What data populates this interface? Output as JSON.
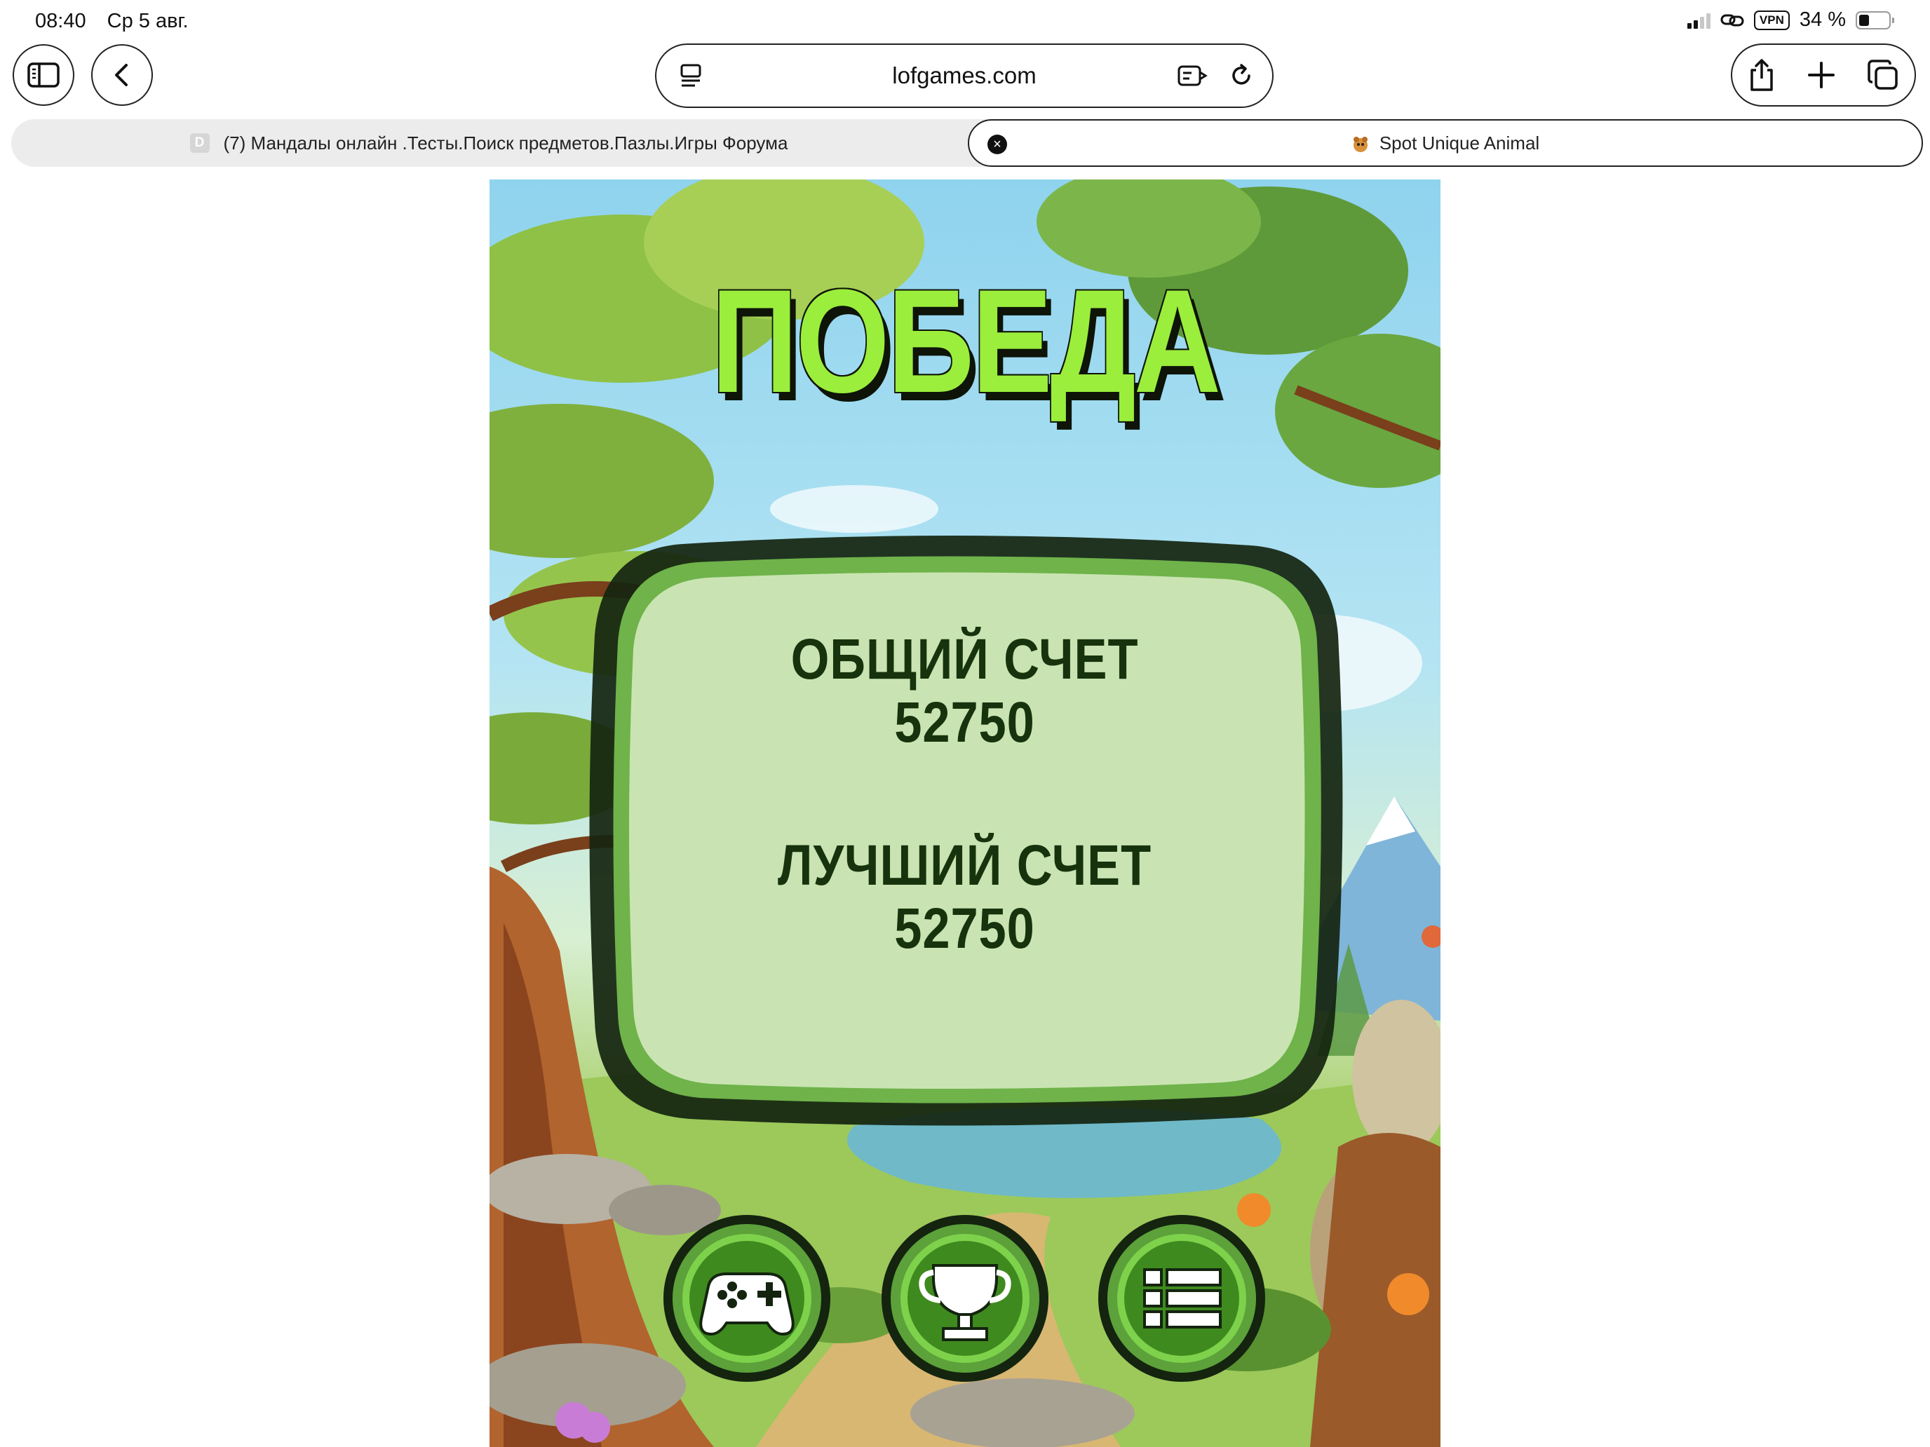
{
  "status_bar": {
    "time": "08:40",
    "date": "Ср 5 авг.",
    "vpn": "VPN",
    "battery": "34 %",
    "battery_level": 0.34
  },
  "toolbar": {
    "url": "lofgames.com",
    "icons": [
      "sidebar-icon",
      "back-icon",
      "reader-icon",
      "translate-icon",
      "reload-icon",
      "share-icon",
      "plus-icon",
      "tabs-icon"
    ]
  },
  "tabs": [
    {
      "favicon": "D",
      "title": "(7) Мандалы онлайн .Тесты.Поиск предметов.Пазлы.Игры Форума",
      "active": false
    },
    {
      "favicon": "animal",
      "title": "Spot Unique Animal",
      "active": true
    }
  ],
  "game": {
    "title": "ПОБЕДА",
    "total_label": "ОБЩИЙ СЧЕТ",
    "total_value": "52750",
    "best_label": "ЛУЧШИЙ СЧЕТ",
    "best_value": "52750",
    "buttons": [
      "gamepad-icon",
      "trophy-icon",
      "menu-list-icon"
    ],
    "colors": {
      "title": "#9bee3c",
      "panel": "#b7d89a",
      "button_green": "#3f8a1f",
      "text": "#16330d"
    }
  }
}
